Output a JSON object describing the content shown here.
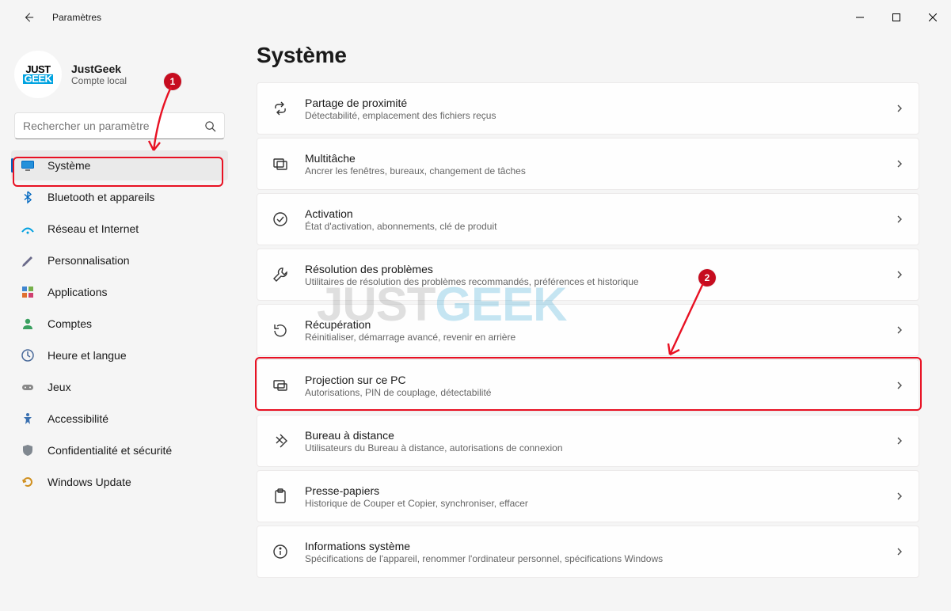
{
  "window": {
    "title": "Paramètres"
  },
  "account": {
    "name": "JustGeek",
    "type": "Compte local",
    "avatar_line1": "JUST",
    "avatar_line2": "GEEK"
  },
  "search": {
    "placeholder": "Rechercher un paramètre"
  },
  "sidebar": {
    "items": [
      {
        "label": "Système",
        "icon": "system",
        "selected": true
      },
      {
        "label": "Bluetooth et appareils",
        "icon": "bluetooth",
        "selected": false
      },
      {
        "label": "Réseau et Internet",
        "icon": "network",
        "selected": false
      },
      {
        "label": "Personnalisation",
        "icon": "personalize",
        "selected": false
      },
      {
        "label": "Applications",
        "icon": "apps",
        "selected": false
      },
      {
        "label": "Comptes",
        "icon": "accounts",
        "selected": false
      },
      {
        "label": "Heure et langue",
        "icon": "time-language",
        "selected": false
      },
      {
        "label": "Jeux",
        "icon": "gaming",
        "selected": false
      },
      {
        "label": "Accessibilité",
        "icon": "accessibility",
        "selected": false
      },
      {
        "label": "Confidentialité et sécurité",
        "icon": "privacy",
        "selected": false
      },
      {
        "label": "Windows Update",
        "icon": "update",
        "selected": false
      }
    ]
  },
  "page": {
    "title": "Système"
  },
  "cards": [
    {
      "icon": "share",
      "title": "Partage de proximité",
      "sub": "Détectabilité, emplacement des fichiers reçus"
    },
    {
      "icon": "multitask",
      "title": "Multitâche",
      "sub": "Ancrer les fenêtres, bureaux, changement de tâches"
    },
    {
      "icon": "activation",
      "title": "Activation",
      "sub": "État d'activation, abonnements, clé de produit"
    },
    {
      "icon": "troubleshoot",
      "title": "Résolution des problèmes",
      "sub": "Utilitaires de résolution des problèmes recommandés, préférences et historique"
    },
    {
      "icon": "recovery",
      "title": "Récupération",
      "sub": "Réinitialiser, démarrage avancé, revenir en arrière"
    },
    {
      "icon": "projection",
      "title": "Projection sur ce PC",
      "sub": "Autorisations, PIN de couplage, détectabilité"
    },
    {
      "icon": "remote",
      "title": "Bureau à distance",
      "sub": "Utilisateurs du Bureau à distance, autorisations de connexion"
    },
    {
      "icon": "clipboard",
      "title": "Presse-papiers",
      "sub": "Historique de Couper et Copier, synchroniser, effacer"
    },
    {
      "icon": "info",
      "title": "Informations système",
      "sub": "Spécifications de l'appareil, renommer l'ordinateur personnel, spécifications Windows"
    }
  ],
  "annotations": {
    "badge1": "1",
    "badge2": "2"
  },
  "watermark": {
    "part1": "JUST",
    "part2": "GEEK"
  }
}
